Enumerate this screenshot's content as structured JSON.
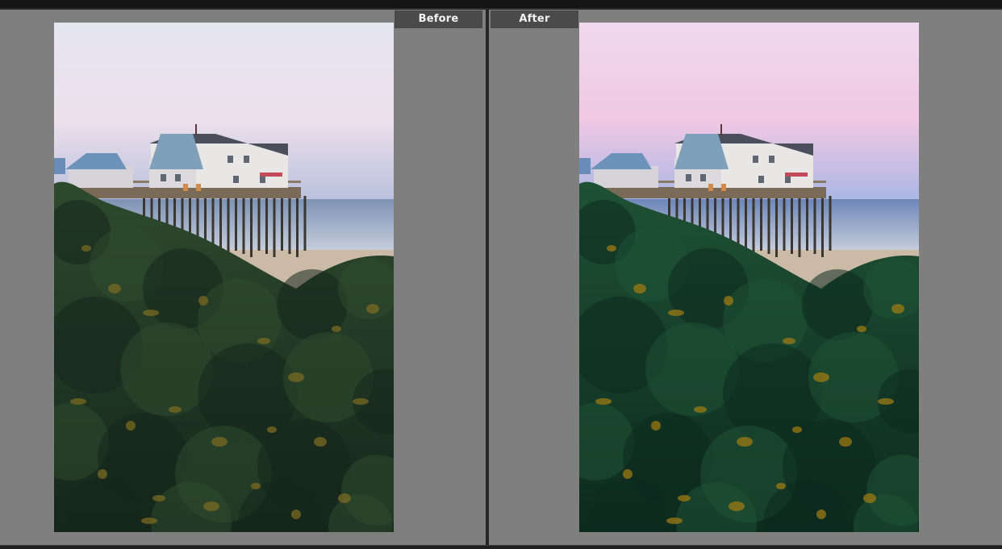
{
  "compare_view": {
    "before_label": "Before",
    "after_label": "After"
  },
  "photos": {
    "before": {
      "icon": "photo-before-image",
      "sky_top": "#e6e6f1",
      "sky_mid": "#ece0ec",
      "sky_horizon": "#b9c0dc",
      "sea": "#7d93b4",
      "foliage_dark": "#15261b",
      "foliage_mid": "#2d4a2e",
      "foliage_accent": "#7a6a22"
    },
    "after": {
      "icon": "photo-after-image",
      "sky_top": "#f0d9ee",
      "sky_mid": "#f0c8e3",
      "sky_horizon": "#a9b6e4",
      "sea": "#6d86b8",
      "foliage_dark": "#0d2a1f",
      "foliage_mid": "#1f5234",
      "foliage_accent": "#9c7a14"
    }
  }
}
